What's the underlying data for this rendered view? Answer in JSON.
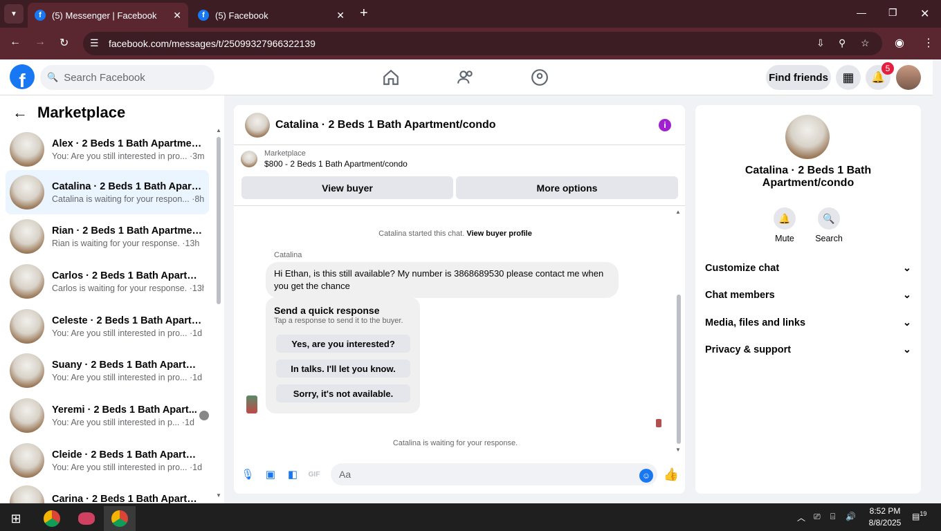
{
  "browser": {
    "tabs": [
      {
        "title": "(5) Messenger | Facebook"
      },
      {
        "title": "(5) Facebook"
      }
    ],
    "url": "facebook.com/messages/t/25099327966322139"
  },
  "fb": {
    "search_placeholder": "Search Facebook",
    "find_friends": "Find friends",
    "notif_count": "5"
  },
  "left": {
    "title": "Marketplace",
    "conversations": [
      {
        "name": "Alex · 2 Beds 1 Bath Apartment/...",
        "preview": "You: Are you still interested in pro...",
        "time": " ·3m"
      },
      {
        "name": "Catalina · 2 Beds 1 Bath Apartm...",
        "preview": "Catalina is waiting for your respon...",
        "time": " ·8h"
      },
      {
        "name": "Rian · 2 Beds 1 Bath Apartment/...",
        "preview": "Rian is waiting for your response.",
        "time": " ·13h"
      },
      {
        "name": "Carlos · 2 Beds 1 Bath Apartmen...",
        "preview": "Carlos is waiting for your response.",
        "time": " ·13h"
      },
      {
        "name": "Celeste · 2 Beds 1 Bath Apartme...",
        "preview": "You: Are you still interested in pro...",
        "time": " ·1d"
      },
      {
        "name": "Suany · 2 Beds 1 Bath Apartmen...",
        "preview": "You: Are you still interested in pro...",
        "time": " ·1d"
      },
      {
        "name": "Yeremi · 2 Beds 1 Bath Apart...",
        "preview": "You: Are you still interested in p...",
        "time": " ·1d"
      },
      {
        "name": "Cleide · 2 Beds 1 Bath Apartmen...",
        "preview": "You: Are you still interested in pro...",
        "time": " ·1d"
      },
      {
        "name": "Carina · 2 Beds 1 Bath Apartmen...",
        "preview": "",
        "time": ""
      }
    ]
  },
  "chat": {
    "title": "Catalina · 2 Beds 1 Bath Apartment/condo",
    "marketplace_label": "Marketplace",
    "listing": "$800 - 2 Beds 1 Bath Apartment/condo",
    "view_buyer": "View buyer",
    "more_options": "More options",
    "started_text": "Catalina started this chat. ",
    "view_buyer_profile": "View buyer profile",
    "sender": "Catalina",
    "message": "Hi Ethan, is this still available? My number is 3868689530 please contact me when you get the chance",
    "quick_title": "Send a quick response",
    "quick_sub": "Tap a response to send it to the buyer.",
    "quick_responses": [
      "Yes, are you interested?",
      "In talks. I'll let you know.",
      "Sorry, it's not available."
    ],
    "waiting": "Catalina is waiting for your response.",
    "input_placeholder": "Aa",
    "gif": "GIF"
  },
  "details": {
    "title": "Catalina · 2 Beds 1 Bath Apartment/condo",
    "mute": "Mute",
    "search": "Search",
    "sections": [
      "Customize chat",
      "Chat members",
      "Media, files and links",
      "Privacy & support"
    ]
  },
  "taskbar": {
    "time": "8:52 PM",
    "date": "8/8/2025",
    "notif": "19"
  },
  "icons": [
    "chevron-down-icon",
    "facebook-icon",
    "close-icon",
    "plus-icon",
    "minimize-icon",
    "maximize-icon",
    "back-icon",
    "forward-icon",
    "reload-icon",
    "site-info-icon",
    "install-icon",
    "zoom-icon",
    "star-icon",
    "profile-icon",
    "menu-icon",
    "search-icon",
    "home-icon",
    "friends-icon",
    "groups-icon",
    "apps-grid-icon",
    "bell-icon",
    "info-icon",
    "mic-icon",
    "image-icon",
    "sticker-icon",
    "gif-icon",
    "emoji-icon",
    "like-icon",
    "windows-icon"
  ],
  "colors": {
    "accent": "#1877f2",
    "info": "#a020d0",
    "chrome_tab": "#5a2731",
    "chrome_frame": "#3c1d23"
  }
}
